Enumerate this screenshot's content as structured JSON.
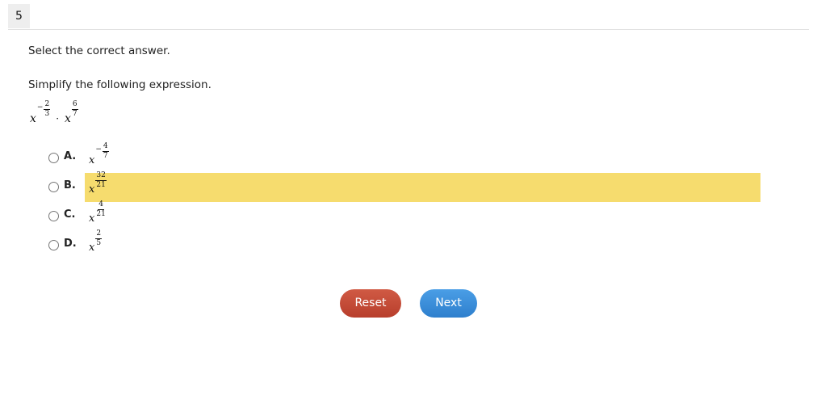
{
  "question": {
    "number": "5",
    "instruction": "Select the correct answer.",
    "prompt": "Simplify the following expression.",
    "expression": {
      "base1": "x",
      "sign1": "−",
      "num1": "2",
      "den1": "3",
      "operator": "·",
      "base2": "x",
      "num2": "6",
      "den2": "7"
    }
  },
  "options": [
    {
      "letter": "A.",
      "base": "x",
      "sign": "−",
      "num": "4",
      "den": "7",
      "highlighted": false
    },
    {
      "letter": "B.",
      "base": "x",
      "sign": "",
      "num": "32",
      "den": "21",
      "highlighted": true
    },
    {
      "letter": "C.",
      "base": "x",
      "sign": "",
      "num": "4",
      "den": "21",
      "highlighted": false
    },
    {
      "letter": "D.",
      "base": "x",
      "sign": "",
      "num": "2",
      "den": "5",
      "highlighted": false
    }
  ],
  "buttons": {
    "reset_label": "Reset",
    "next_label": "Next"
  },
  "colors": {
    "highlight": "#f6dc6e",
    "reset": "#c94a36",
    "next": "#3a8fdc"
  }
}
